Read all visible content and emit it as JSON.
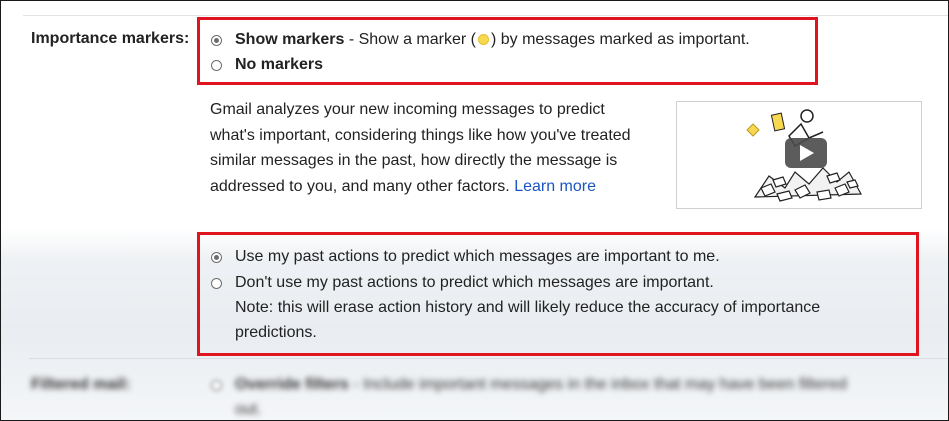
{
  "section": {
    "label": "Importance markers:"
  },
  "markers": {
    "show": {
      "title": "Show markers",
      "desc_before": " - Show a marker (",
      "desc_after": ") by messages marked as important.",
      "checked": true
    },
    "none": {
      "title": "No markers",
      "checked": false
    }
  },
  "description": {
    "text": "Gmail analyzes your new incoming messages to predict what's important, considering things like how you've treated similar messages in the past, how directly the message is addressed to you, and many other factors.",
    "link": "Learn more"
  },
  "predict": {
    "use": {
      "text": "Use my past actions to predict which messages are important to me.",
      "checked": true
    },
    "dont": {
      "text": "Don't use my past actions to predict which messages are important.",
      "checked": false
    },
    "note_line1": "Note: this will erase action history and will likely reduce the accuracy of importance",
    "note_line2": "predictions."
  },
  "next_section": {
    "label": "Filtered mail:",
    "option_title": "Override filters",
    "option_desc": " - Include important messages in the inbox that may have been filtered",
    "option_desc2": "out."
  },
  "colors": {
    "highlight": "#e0141e",
    "marker": "#f7d84f",
    "link": "#1a55c0"
  },
  "icons": {
    "video": "play-icon",
    "marker": "importance-marker-icon"
  }
}
